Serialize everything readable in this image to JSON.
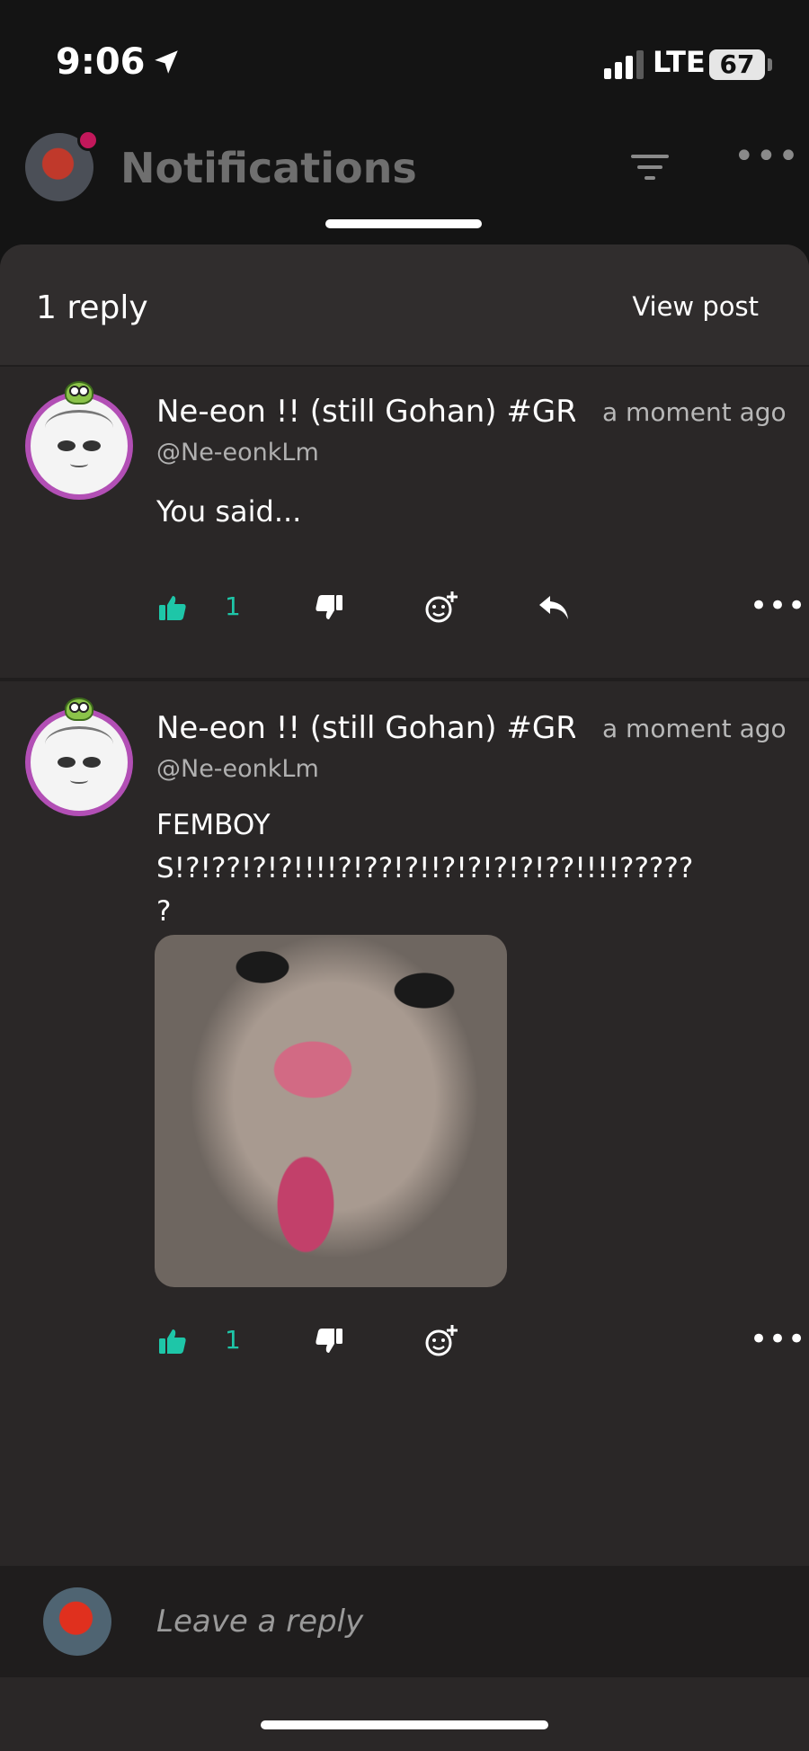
{
  "status_bar": {
    "time": "9:06",
    "network": "LTE",
    "battery": "67",
    "location_icon": "location-arrow-icon",
    "signal_icon": "signal-bars-icon"
  },
  "header": {
    "title": "Notifications",
    "filter_icon": "filter-icon",
    "more_icon": "more-horizontal-icon"
  },
  "sheet": {
    "title": "1 reply",
    "view_post_label": "View post"
  },
  "comments": [
    {
      "name": "Ne-eon !! (still Gohan) #GR",
      "handle": "@Ne-eonkLm",
      "time": "a moment ago",
      "body": "You said...",
      "likes": "1",
      "has_image": false
    },
    {
      "name": "Ne-eon !! (still Gohan) #GR",
      "handle": "@Ne-eonkLm",
      "time": "a moment ago",
      "body": "FEMBOYS!?!??!?!?!!!!?!??!?!!?!?!?!?!??!!!!?????\n?",
      "likes": "1",
      "has_image": true,
      "image_icon": "cat-meme-image"
    }
  ],
  "reply_bar": {
    "placeholder": "Leave a reply"
  },
  "colors": {
    "accent_like": "#1ec6a8",
    "sheet_bg": "#2a2727",
    "avatar_ring": "#b24fb5"
  }
}
